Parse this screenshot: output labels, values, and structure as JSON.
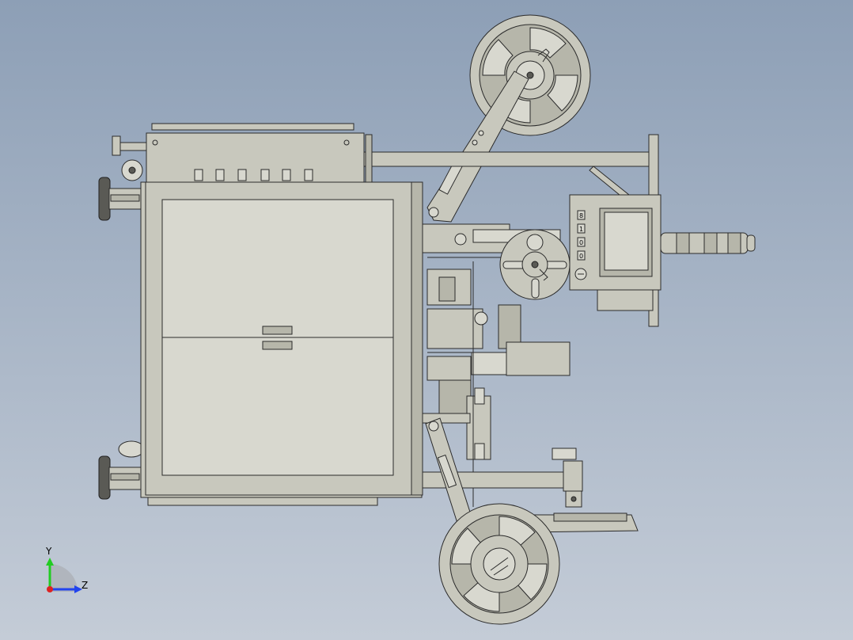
{
  "view": {
    "background_top": "#8d9fb6",
    "background_bottom": "#c4ccd7",
    "part_fill": "#c8c8bd",
    "part_stroke": "#2b2b2b"
  },
  "triad": {
    "y_label": "Y",
    "z_label": "Z",
    "y_color": "#22cc22",
    "z_color": "#2244ee",
    "x_color": "#dd2222"
  },
  "hmi": {
    "buttons": [
      "8",
      "1",
      "0",
      "0"
    ]
  }
}
